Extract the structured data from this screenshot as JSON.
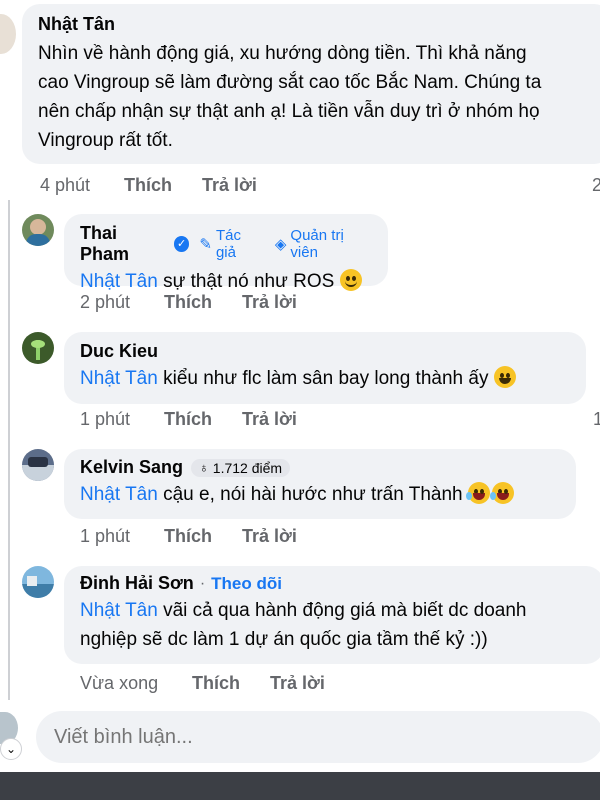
{
  "main_comment": {
    "author": "Nhật Tân",
    "text": "Nhìn về hành động giá, xu hướng dòng tiền. Thì khả năng\ncao Vingroup sẽ làm đường sắt cao tốc Bắc Nam. Chúng ta\nnên chấp nhận sự thật anh ạ! Là tiền vẫn duy trì ở nhóm họ\nVingroup rất tốt.",
    "time": "4 phút",
    "like": "Thích",
    "reply": "Trả lời",
    "reaction_count": "2"
  },
  "replies": [
    {
      "author": "Thai Pham",
      "badges": [
        "Tác giả",
        "Quản trị viên"
      ],
      "mention": "Nhật Tân",
      "text": " sự thật nó như ROS ",
      "emoji": "slightly-smiling-face",
      "time": "2 phút",
      "like": "Thích",
      "reply": "Trả lời"
    },
    {
      "author": "Duc Kieu",
      "mention": "Nhật Tân",
      "text": " kiểu như flc làm sân bay long thành ấy ",
      "emoji": "grinning-face",
      "time": "1 phút",
      "like": "Thích",
      "reply": "Trả lời",
      "reaction_count": "1"
    },
    {
      "author": "Kelvin Sang",
      "points": "1.712 điểm",
      "mention": "Nhật Tân",
      "text": " cậu e, nói hài hước như trấn Thành ",
      "emoji": "rolling-on-floor-laughing",
      "time": "1 phút",
      "like": "Thích",
      "reply": "Trả lời"
    },
    {
      "author": "Đinh Hải Sơn",
      "follow_sep": "·",
      "follow": "Theo dõi",
      "mention": "Nhật Tân",
      "text": " vãi cả qua hành động giá mà biết dc doanh\nnghiệp sẽ dc làm 1 dự án quốc gia tầm thế kỷ :))",
      "time": "Vừa xong",
      "like": "Thích",
      "reply": "Trả lời"
    }
  ],
  "composer": {
    "placeholder": "Viết bình luận..."
  },
  "colors": {
    "bubble": "#f0f2f5",
    "link": "#1877f2",
    "meta": "#65676b"
  }
}
